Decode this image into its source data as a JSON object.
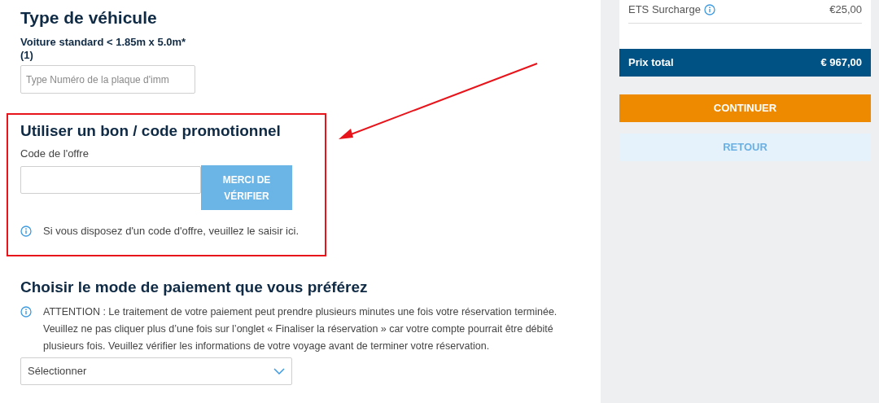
{
  "vehicle": {
    "title": "Type de véhicule",
    "label": "Voiture standard < 1.85m x 5.0m*",
    "label_note": "(1)",
    "plate_placeholder": "Type Numéro de la plaque d'imm"
  },
  "promo": {
    "title": "Utiliser un bon / code promotionnel",
    "field_label": "Code de l'offre",
    "button_lines": [
      "MERCI DE",
      "VÉRIFIER"
    ],
    "hint": "Si vous disposez d'un code d'offre, veuillez le saisir ici."
  },
  "payment": {
    "title": "Choisir le mode de paiement que vous préférez",
    "notice": "ATTENTION : Le traitement de votre paiement peut prendre plusieurs minutes une fois votre réservation terminée. Veuillez ne pas cliquer plus d’une fois sur l’onglet « Finaliser la réservation » car votre compte pourrait être débité plusieurs fois. Veuillez vérifier les informations de votre voyage avant de terminer votre réservation.",
    "select_value": "Sélectionner"
  },
  "summary": {
    "surcharge_label": "ETS Surcharge",
    "surcharge_value": "€25,00",
    "total_label": "Prix total",
    "total_value": "€ 967,00"
  },
  "buttons": [
    {
      "label": "CONTINUER",
      "kind": "primary"
    },
    {
      "label": "RETOUR",
      "kind": "secondary"
    }
  ]
}
